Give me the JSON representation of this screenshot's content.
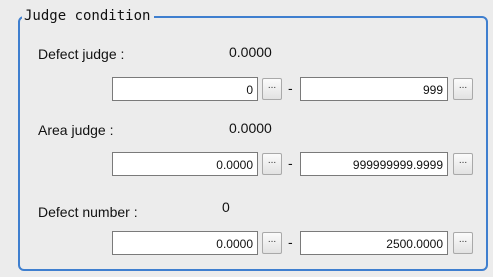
{
  "group": {
    "title": "Judge condition"
  },
  "rows": [
    {
      "label": "Defect judge :",
      "value": "0.0000",
      "min": "0",
      "max": "999"
    },
    {
      "label": "Area judge :",
      "value": "0.0000",
      "min": "0.0000",
      "max": "999999999.9999"
    },
    {
      "label": "Defect number :",
      "value": "0",
      "min": "0.0000",
      "max": "2500.0000"
    }
  ],
  "buttons": {
    "ellipsis": "..."
  },
  "separator": "-"
}
